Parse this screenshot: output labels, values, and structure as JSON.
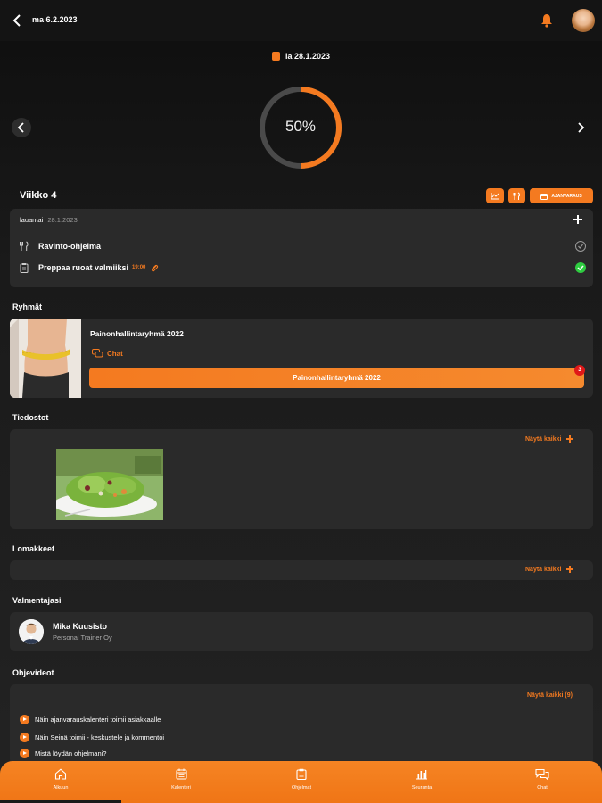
{
  "header": {
    "date": "ma 6.2.2023"
  },
  "day": {
    "date": "la 28.1.2023"
  },
  "progress": {
    "percent_label": "50%",
    "value": 0.5
  },
  "week": {
    "title": "Viikko 4",
    "button_icons": [
      "chart-icon",
      "food-icon"
    ],
    "calendar_button_label": "AJANVARAUS"
  },
  "day_card": {
    "weekday": "lauantai",
    "date": "28.1.2023",
    "tasks": [
      {
        "label": "Ravinto-ohjelma",
        "time": "",
        "icon": "food-icon",
        "status": "pending"
      },
      {
        "label": "Preppaa ruoat valmiiksi",
        "time": "19:00",
        "icon": "clipboard-icon",
        "status": "done"
      }
    ]
  },
  "groups": {
    "title": "Ryhmät",
    "name": "Painonhallintaryhmä 2022",
    "chat_label": "Chat",
    "button_label": "Painonhallintaryhmä 2022",
    "badge_count": "3"
  },
  "files": {
    "title": "Tiedostot",
    "show_all": "Näytä kaikki"
  },
  "forms": {
    "title": "Lomakkeet",
    "show_all": "Näytä kaikki"
  },
  "coach": {
    "title": "Valmentajasi",
    "name": "Mika Kuusisto",
    "company": "Personal Trainer Oy"
  },
  "videos": {
    "title": "Ohjevideot",
    "show_all": "Näytä kaikki (9)",
    "items": [
      "Näin ajanvarauskalenteri toimii asiakkaalle",
      "Näin Seinä toimii - keskustele ja kommentoi",
      "Mistä löydän ohjelmani?"
    ]
  },
  "bottom_nav": {
    "items": [
      {
        "label": "Alkuun",
        "icon": "home-icon"
      },
      {
        "label": "Kalenteri",
        "icon": "calendar-icon"
      },
      {
        "label": "Ohjelmat",
        "icon": "clipboard-icon"
      },
      {
        "label": "Seuranta",
        "icon": "chart-icon"
      },
      {
        "label": "Chat",
        "icon": "chat-icon"
      }
    ]
  },
  "colors": {
    "accent": "#f47a20",
    "done": "#2ecc40",
    "badge": "#e01818",
    "card": "#2a2a2a"
  }
}
